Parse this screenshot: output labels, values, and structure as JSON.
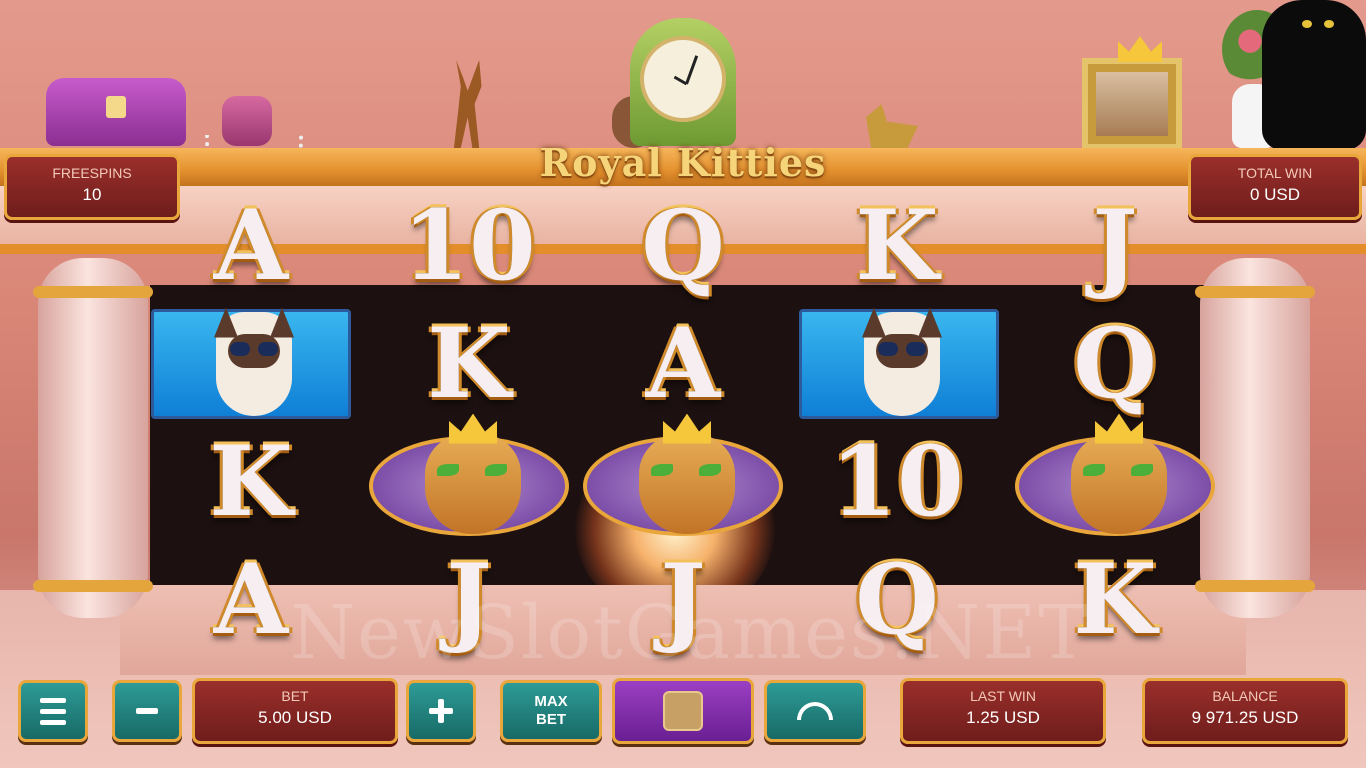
{
  "game": {
    "logo_line": "Royal Kitties",
    "watermark": "NewSlotGames.NET"
  },
  "hud_top": {
    "freespins": {
      "label": "FREESPINS",
      "value": "10"
    },
    "total_win": {
      "label": "TOTAL WIN",
      "value": "0 USD"
    }
  },
  "reels": [
    {
      "symbols": [
        "A",
        "siamese",
        "K",
        "A"
      ]
    },
    {
      "symbols": [
        "10",
        "K",
        "royal",
        "J"
      ]
    },
    {
      "symbols": [
        "Q",
        "A",
        "royal",
        "J"
      ]
    },
    {
      "symbols": [
        "K",
        "siamese",
        "10",
        "Q"
      ]
    },
    {
      "symbols": [
        "J",
        "Q",
        "royal",
        "K"
      ]
    }
  ],
  "reel_letters": {
    "r1s1": "A",
    "r1s3": "K",
    "r1s4": "A",
    "r2s1": "10",
    "r2s2": "K",
    "r2s4": "J",
    "r3s1": "Q",
    "r3s2": "A",
    "r3s4": "J",
    "r4s1": "K",
    "r4s3": "10",
    "r4s4": "Q",
    "r5s1": "J",
    "r5s2": "Q",
    "r5s4": "K"
  },
  "controls": {
    "menu_icon": "hamburger-icon",
    "minus_icon": "minus-icon",
    "plus_icon": "plus-icon",
    "bet": {
      "label": "BET",
      "value": "5.00 USD"
    },
    "max_bet_line1": "MAX",
    "max_bet_line2": "BET",
    "stop_icon": "stop-square-icon",
    "autoplay_icon": "autoplay-arrow-icon",
    "last_win": {
      "label": "LAST WIN",
      "value": "1.25 USD"
    },
    "balance": {
      "label": "BALANCE",
      "value": "9 971.25 USD"
    }
  },
  "colors": {
    "gold_accent": "#e9a63a",
    "panel_red": "#7f2323",
    "button_teal": "#1f807b",
    "button_purple": "#7d2aa8"
  }
}
